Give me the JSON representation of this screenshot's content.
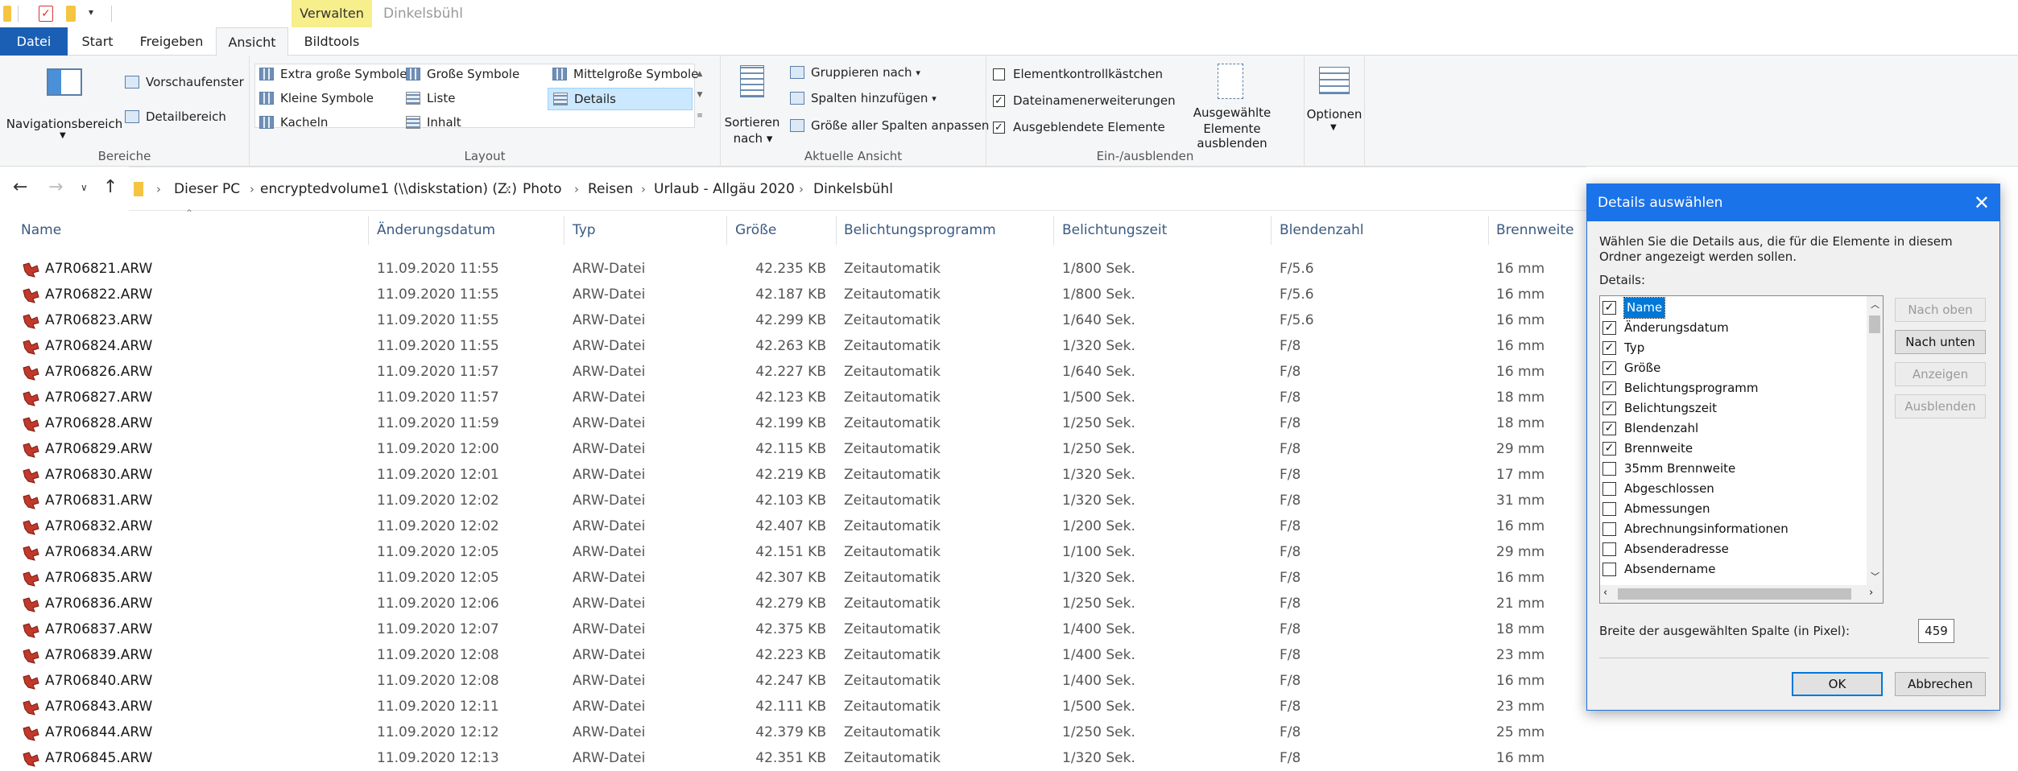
{
  "window": {
    "title": "Dinkelsbühl",
    "context_group": "Verwalten"
  },
  "tabs": [
    {
      "label": "Datei"
    },
    {
      "label": "Start"
    },
    {
      "label": "Freigeben"
    },
    {
      "label": "Ansicht"
    },
    {
      "label": "Bildtools"
    }
  ],
  "ribbon": {
    "bereiche": {
      "label": "Bereiche",
      "navigationsbereich": "Navigationsbereich",
      "vorschaufenster": "Vorschaufenster",
      "detailbereich": "Detailbereich"
    },
    "layout": {
      "label": "Layout",
      "items": [
        "Extra große Symbole",
        "Große Symbole",
        "Mittelgroße Symbole",
        "Kleine Symbole",
        "Liste",
        "Details",
        "Kacheln",
        "Inhalt"
      ]
    },
    "aktuelle_ansicht": {
      "label": "Aktuelle Ansicht",
      "sortieren_1": "Sortieren",
      "sortieren_2": "nach",
      "gruppieren": "Gruppieren nach",
      "spalten": "Spalten hinzufügen",
      "groesse": "Größe aller Spalten anpassen"
    },
    "ein_ausblenden": {
      "label": "Ein-/ausblenden",
      "elementkontroll": "Elementkontrollkästchen",
      "dateinamen": "Dateinamenerweiterungen",
      "ausgeblendete": "Ausgeblendete Elemente",
      "ausgewaehlte_1": "Ausgewählte",
      "ausgewaehlte_2": "Elemente ausblenden"
    },
    "optionen": "Optionen"
  },
  "breadcrumb": [
    "Dieser PC",
    "encryptedvolume1 (\\\\diskstation) (Z:)",
    "Photo",
    "Reisen",
    "Urlaub - Allgäu 2020",
    "Dinkelsbühl"
  ],
  "columns": [
    "Name",
    "Änderungsdatum",
    "Typ",
    "Größe",
    "Belichtungsprogramm",
    "Belichtungszeit",
    "Blendenzahl",
    "Brennweite"
  ],
  "files": [
    [
      "A7R06821.ARW",
      "11.09.2020 11:55",
      "ARW-Datei",
      "42.235 KB",
      "Zeitautomatik",
      "1/800 Sek.",
      "F/5.6",
      "16 mm"
    ],
    [
      "A7R06822.ARW",
      "11.09.2020 11:55",
      "ARW-Datei",
      "42.187 KB",
      "Zeitautomatik",
      "1/800 Sek.",
      "F/5.6",
      "16 mm"
    ],
    [
      "A7R06823.ARW",
      "11.09.2020 11:55",
      "ARW-Datei",
      "42.299 KB",
      "Zeitautomatik",
      "1/640 Sek.",
      "F/5.6",
      "16 mm"
    ],
    [
      "A7R06824.ARW",
      "11.09.2020 11:55",
      "ARW-Datei",
      "42.263 KB",
      "Zeitautomatik",
      "1/320 Sek.",
      "F/8",
      "16 mm"
    ],
    [
      "A7R06826.ARW",
      "11.09.2020 11:57",
      "ARW-Datei",
      "42.227 KB",
      "Zeitautomatik",
      "1/640 Sek.",
      "F/8",
      "16 mm"
    ],
    [
      "A7R06827.ARW",
      "11.09.2020 11:57",
      "ARW-Datei",
      "42.123 KB",
      "Zeitautomatik",
      "1/500 Sek.",
      "F/8",
      "18 mm"
    ],
    [
      "A7R06828.ARW",
      "11.09.2020 11:59",
      "ARW-Datei",
      "42.199 KB",
      "Zeitautomatik",
      "1/250 Sek.",
      "F/8",
      "18 mm"
    ],
    [
      "A7R06829.ARW",
      "11.09.2020 12:00",
      "ARW-Datei",
      "42.115 KB",
      "Zeitautomatik",
      "1/250 Sek.",
      "F/8",
      "29 mm"
    ],
    [
      "A7R06830.ARW",
      "11.09.2020 12:01",
      "ARW-Datei",
      "42.219 KB",
      "Zeitautomatik",
      "1/320 Sek.",
      "F/8",
      "17 mm"
    ],
    [
      "A7R06831.ARW",
      "11.09.2020 12:02",
      "ARW-Datei",
      "42.103 KB",
      "Zeitautomatik",
      "1/320 Sek.",
      "F/8",
      "31 mm"
    ],
    [
      "A7R06832.ARW",
      "11.09.2020 12:02",
      "ARW-Datei",
      "42.407 KB",
      "Zeitautomatik",
      "1/200 Sek.",
      "F/8",
      "16 mm"
    ],
    [
      "A7R06834.ARW",
      "11.09.2020 12:05",
      "ARW-Datei",
      "42.151 KB",
      "Zeitautomatik",
      "1/100 Sek.",
      "F/8",
      "29 mm"
    ],
    [
      "A7R06835.ARW",
      "11.09.2020 12:05",
      "ARW-Datei",
      "42.307 KB",
      "Zeitautomatik",
      "1/320 Sek.",
      "F/8",
      "16 mm"
    ],
    [
      "A7R06836.ARW",
      "11.09.2020 12:06",
      "ARW-Datei",
      "42.279 KB",
      "Zeitautomatik",
      "1/250 Sek.",
      "F/8",
      "21 mm"
    ],
    [
      "A7R06837.ARW",
      "11.09.2020 12:07",
      "ARW-Datei",
      "42.375 KB",
      "Zeitautomatik",
      "1/400 Sek.",
      "F/8",
      "18 mm"
    ],
    [
      "A7R06839.ARW",
      "11.09.2020 12:08",
      "ARW-Datei",
      "42.223 KB",
      "Zeitautomatik",
      "1/400 Sek.",
      "F/8",
      "23 mm"
    ],
    [
      "A7R06840.ARW",
      "11.09.2020 12:08",
      "ARW-Datei",
      "42.247 KB",
      "Zeitautomatik",
      "1/400 Sek.",
      "F/8",
      "16 mm"
    ],
    [
      "A7R06843.ARW",
      "11.09.2020 12:11",
      "ARW-Datei",
      "42.111 KB",
      "Zeitautomatik",
      "1/500 Sek.",
      "F/8",
      "23 mm"
    ],
    [
      "A7R06844.ARW",
      "11.09.2020 12:12",
      "ARW-Datei",
      "42.379 KB",
      "Zeitautomatik",
      "1/250 Sek.",
      "F/8",
      "25 mm"
    ],
    [
      "A7R06845.ARW",
      "11.09.2020 12:13",
      "ARW-Datei",
      "42.351 KB",
      "Zeitautomatik",
      "1/320 Sek.",
      "F/8",
      "16 mm"
    ]
  ],
  "dialog": {
    "title": "Details auswählen",
    "description": "Wählen Sie die Details aus, die für die Elemente in diesem Ordner angezeigt werden sollen.",
    "details_label": "Details:",
    "items": [
      {
        "label": "Name",
        "checked": true
      },
      {
        "label": "Änderungsdatum",
        "checked": true
      },
      {
        "label": "Typ",
        "checked": true
      },
      {
        "label": "Größe",
        "checked": true
      },
      {
        "label": "Belichtungsprogramm",
        "checked": true
      },
      {
        "label": "Belichtungszeit",
        "checked": true
      },
      {
        "label": "Blendenzahl",
        "checked": true
      },
      {
        "label": "Brennweite",
        "checked": true
      },
      {
        "label": "35mm Brennweite",
        "checked": false
      },
      {
        "label": "Abgeschlossen",
        "checked": false
      },
      {
        "label": "Abmessungen",
        "checked": false
      },
      {
        "label": "Abrechnungsinformationen",
        "checked": false
      },
      {
        "label": "Absenderadresse",
        "checked": false
      },
      {
        "label": "Absendername",
        "checked": false
      }
    ],
    "buttons": {
      "nach_oben": "Nach oben",
      "nach_unten": "Nach unten",
      "anzeigen": "Anzeigen",
      "ausblenden": "Ausblenden",
      "ok": "OK",
      "abbrechen": "Abbrechen"
    },
    "width_label": "Breite der ausgewählten Spalte (in Pixel):",
    "width_value": "459"
  },
  "colors": {
    "accent": "#1a73e8",
    "file_tab": "#1a5fb4",
    "context_tab": "#f7ee8c"
  }
}
